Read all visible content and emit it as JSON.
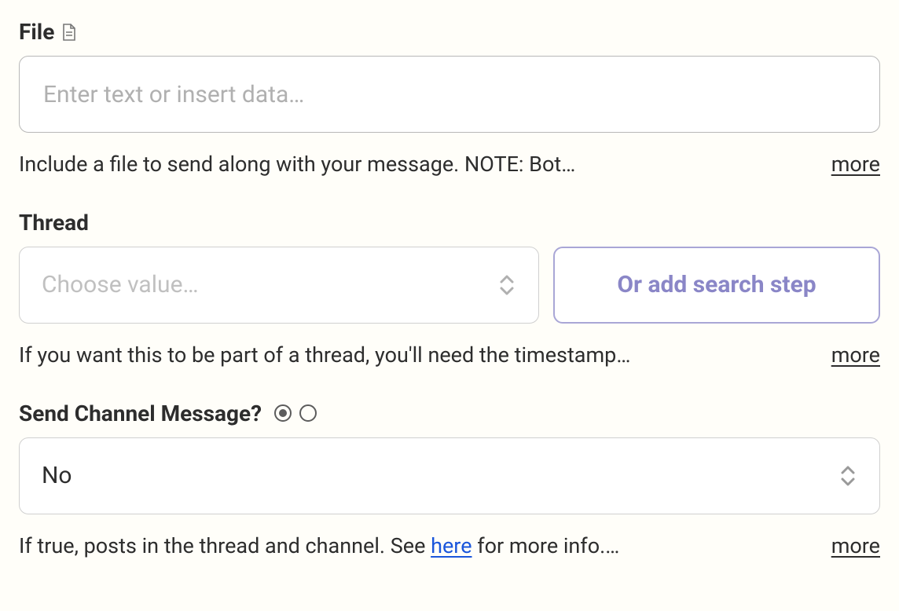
{
  "file": {
    "label": "File",
    "placeholder": "Enter text or insert data…",
    "helper": "Include a file to send along with your message. NOTE: Bot…",
    "more": "more"
  },
  "thread": {
    "label": "Thread",
    "select_placeholder": "Choose value…",
    "search_step_label": "Or add search step",
    "helper": "If you want this to be part of a thread, you'll need the timestamp…",
    "more": "more"
  },
  "sendChannel": {
    "label": "Send Channel Message?",
    "value": "No",
    "helper_before": "If true, posts in the thread and channel. See ",
    "helper_link": "here",
    "helper_after": " for more info.…",
    "more": "more"
  }
}
